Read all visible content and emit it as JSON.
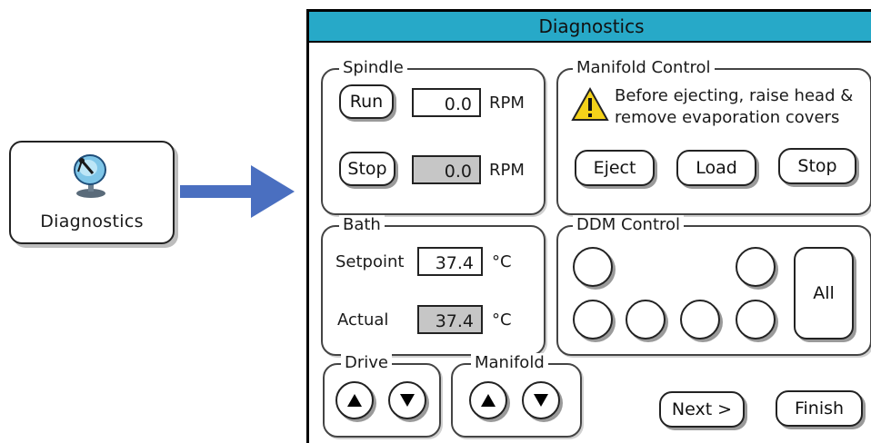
{
  "launcher": {
    "label": "Diagnostics",
    "icon": "satellite-dish-icon"
  },
  "window": {
    "title": "Diagnostics",
    "accent_color": "#27a9c8",
    "spindle": {
      "legend": "Spindle",
      "run_label": "Run",
      "stop_label": "Stop",
      "set_rpm": "0.0",
      "actual_rpm": "0.0",
      "unit": "RPM"
    },
    "manifold_control": {
      "legend": "Manifold Control",
      "warning_line1": "Before ejecting, raise head &",
      "warning_line2": "remove evaporation covers",
      "warning_icon": "warning-icon",
      "eject_label": "Eject",
      "load_label": "Load",
      "stop_label": "Stop"
    },
    "bath": {
      "legend": "Bath",
      "setpoint_label": "Setpoint",
      "setpoint_value": "37.4",
      "actual_label": "Actual",
      "actual_value": "37.4",
      "unit": "°C"
    },
    "ddm_control": {
      "legend": "DDM Control",
      "all_label": "All"
    },
    "drive": {
      "legend": "Drive",
      "up_icon": "up-arrow-icon",
      "down_icon": "down-arrow-icon"
    },
    "manifold": {
      "legend": "Manifold",
      "up_icon": "up-arrow-icon",
      "down_icon": "down-arrow-icon"
    },
    "next_label": "Next >",
    "finish_label": "Finish"
  }
}
